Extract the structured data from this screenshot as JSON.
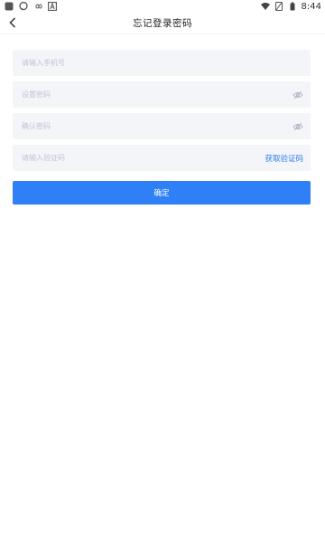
{
  "status_bar": {
    "time": "8:44",
    "left_icons": [
      "app-icon",
      "chat-bubble-icon",
      "infinity-icon",
      "a-box-icon"
    ],
    "right_icons": [
      "wifi-icon",
      "no-sim-icon",
      "battery-icon"
    ]
  },
  "header": {
    "title": "忘记登录密码",
    "back_icon": "chevron-left-icon"
  },
  "form": {
    "phone_placeholder": "请输入手机号",
    "password_placeholder": "设置密码",
    "confirm_placeholder": "确认密码",
    "code_placeholder": "请输入验证码",
    "get_code_label": "获取验证码",
    "eye_icon": "eye-off-icon"
  },
  "actions": {
    "confirm_label": "确定"
  },
  "colors": {
    "accent": "#2f80f7",
    "field_bg": "#f4f5f9",
    "placeholder": "#c2c4cf"
  }
}
